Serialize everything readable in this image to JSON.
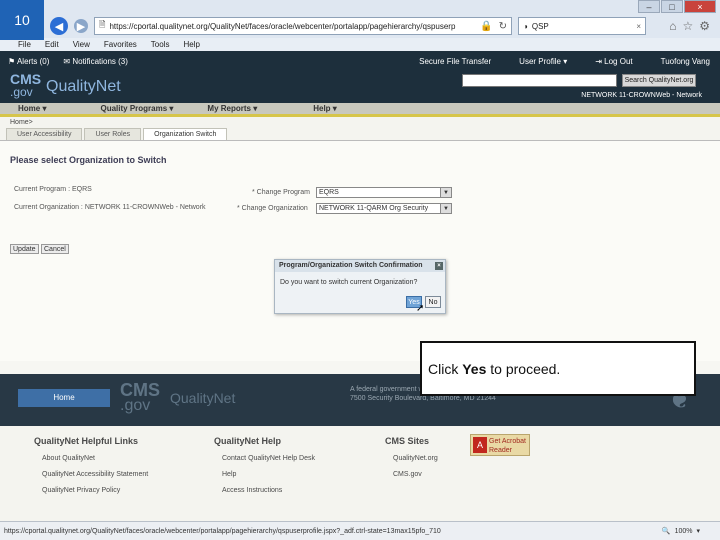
{
  "slide_number": "10",
  "browser": {
    "url": "https://cportal.qualitynet.org/QualityNet/faces/oracle/webcenter/portalapp/pagehierarchy/qspuserp",
    "tab_title": "QSP",
    "tab_close": "×",
    "window_controls": [
      "–",
      "□",
      "×"
    ],
    "menu": [
      "File",
      "Edit",
      "View",
      "Favorites",
      "Tools",
      "Help"
    ],
    "status_url": "https://cportal.qualitynet.org/QualityNet/faces/oracle/webcenter/portalapp/pagehierarchy/qspuserprofile.jspx?_adf.ctrl-state=13max15pfo_710",
    "zoom": "100%"
  },
  "topstrip": {
    "alerts": "Alerts (0)",
    "notifications": "Notifications (3)",
    "secure_file_transfer": "Secure File Transfer",
    "user_profile": "User Profile",
    "log_out": "Log Out",
    "user_name": "Tuofong Vang",
    "network": "NETWORK 11-CROWNWeb - Network"
  },
  "header": {
    "logo_cms": "CMS",
    "logo_gov": ".gov",
    "logo_qn": "QualityNet",
    "search_button": "Search QualityNet.org"
  },
  "mainnav": [
    "Home",
    "Quality Programs",
    "My Reports",
    "Help"
  ],
  "breadcrumb": "Home>",
  "subtabs": [
    "User Accessibility",
    "User Roles",
    "Organization Switch"
  ],
  "content": {
    "title": "Please select Organization to Switch",
    "current_program_label": "Current Program :",
    "current_program_value": "EQRS",
    "current_org_label": "Current Organization :",
    "current_org_value": "NETWORK 11-CROWNWeb - Network",
    "change_program_label": "* Change Program",
    "change_program_value": "EQRS",
    "change_org_label": "* Change Organization",
    "change_org_value": "NETWORK 11-QARM Org Security",
    "update_button": "Update",
    "cancel_button": "Cancel"
  },
  "modal": {
    "title": "Program/Organization Switch Confirmation",
    "message": "Do you want to switch current Organization?",
    "yes": "Yes",
    "no": "No",
    "close": "×"
  },
  "callout": {
    "prefix": "Click ",
    "emphasis": "Yes",
    "suffix": " to proceed."
  },
  "footer": {
    "home": "Home",
    "cms": "CMS",
    "gov": ".gov",
    "qn": "QualityNet",
    "fed_line1": "A federal government website managed by the",
    "fed_line2": "7500 Security Boulevard, Baltimore, MD 21244"
  },
  "links": {
    "col1_title": "QualityNet Helpful Links",
    "col1": [
      "About QualityNet",
      "QualityNet Accessibility Statement",
      "QualityNet Privacy Policy"
    ],
    "col2_title": "QualityNet Help",
    "col2": [
      "Contact QualityNet Help Desk",
      "Help",
      "Access Instructions"
    ],
    "col3_title": "CMS Sites",
    "col3": [
      "QualityNet.org",
      "CMS.gov"
    ],
    "acrobat": "Get Acrobat Reader"
  }
}
